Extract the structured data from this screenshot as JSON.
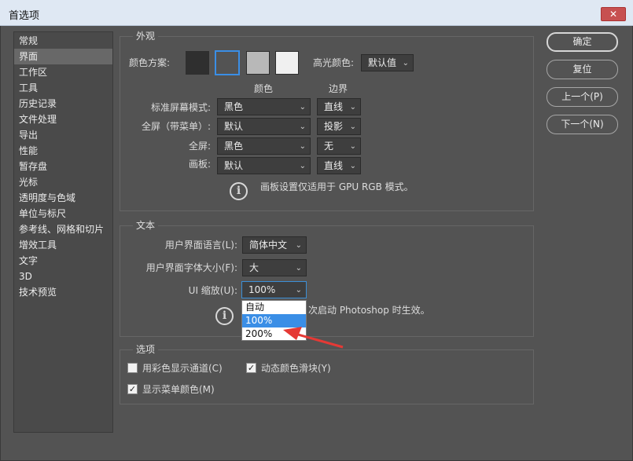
{
  "window": {
    "title": "首选项",
    "close_label": "✕"
  },
  "sidebar": {
    "items": [
      "常规",
      "界面",
      "工作区",
      "工具",
      "历史记录",
      "文件处理",
      "导出",
      "性能",
      "暂存盘",
      "光标",
      "透明度与色域",
      "单位与标尺",
      "参考线、网格和切片",
      "增效工具",
      "文字",
      "3D",
      "技术预览"
    ],
    "selected_index": 1
  },
  "appearance": {
    "title": "外观",
    "color_scheme_label": "颜色方案:",
    "swatch_colors": [
      "#2f2f2f",
      "#535353",
      "#b8b8b8",
      "#f0f0f0"
    ],
    "swatch_selected_index": 1,
    "highlight_label": "高光颜色:",
    "highlight_value": "默认值",
    "col_color": "颜色",
    "col_border": "边界",
    "rows": [
      {
        "label": "标准屏幕模式:",
        "color": "黑色",
        "border": "直线"
      },
      {
        "label": "全屏（带菜单）:",
        "color": "默认",
        "border": "投影"
      },
      {
        "label": "全屏:",
        "color": "黑色",
        "border": "无"
      },
      {
        "label": "画板:",
        "color": "默认",
        "border": "直线"
      }
    ],
    "note": "画板设置仅适用于 GPU RGB 模式。"
  },
  "text": {
    "title": "文本",
    "language_label": "用户界面语言(L):",
    "language_value": "简体中文",
    "font_size_label": "用户界面字体大小(F):",
    "font_size_value": "大",
    "ui_scale_label": "UI 缩放(U):",
    "ui_scale_value": "100%",
    "note_visible": "次启动 Photoshop 时生效。",
    "dropdown_options": [
      "自动",
      "100%",
      "200%"
    ],
    "dropdown_highlight_index": 1
  },
  "options": {
    "title": "选项",
    "show_channels_color": {
      "label": "用彩色显示通道(C)",
      "checked": false
    },
    "dynamic_color_sliders": {
      "label": "动态颜色滑块(Y)",
      "checked": true
    },
    "show_menu_colors": {
      "label": "显示菜单颜色(M)",
      "checked": true
    }
  },
  "buttons": {
    "ok": "确定",
    "reset": "复位",
    "prev": "上一个(P)",
    "next": "下一个(N)"
  },
  "icons": {
    "info": "info-icon",
    "chevron": "chevron-down-icon",
    "check": "checkmark-icon",
    "close": "close-icon"
  },
  "colors": {
    "accent": "#3a8ee6",
    "annotation_arrow": "#e53935"
  }
}
